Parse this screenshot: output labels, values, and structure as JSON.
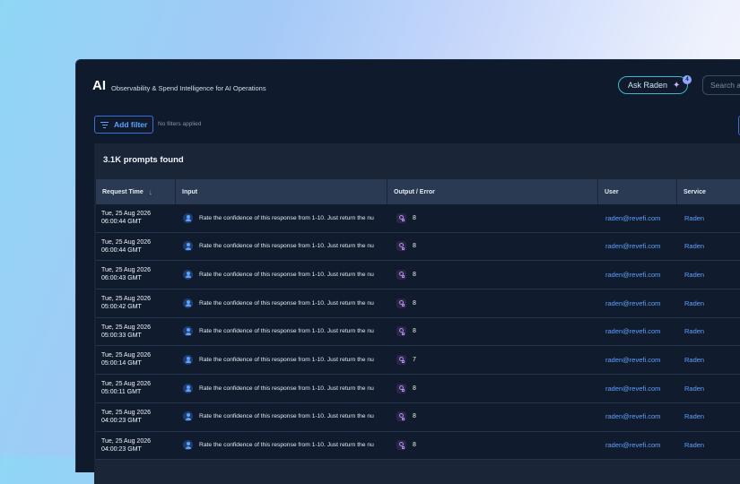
{
  "header": {
    "logo": "AI",
    "subtitle": "Observability & Spend Intelligence for AI Operations",
    "ask_label": "Ask Raden",
    "ask_badge": "4",
    "search_placeholder": "Search a"
  },
  "filters": {
    "add_label": "Add filter",
    "status": "No filters applied"
  },
  "results": {
    "count_label": "3.1K prompts found"
  },
  "table": {
    "columns": [
      "Request Time",
      "Input",
      "Output / Error",
      "User",
      "Service"
    ],
    "rows": [
      {
        "date": "Tue, 25 Aug 2026",
        "time": "06:00:44 GMT",
        "input": "Rate the confidence of this response from 1-10. Just return the nu",
        "output": "8",
        "user": "raden@revefi.com",
        "service": "Raden"
      },
      {
        "date": "Tue, 25 Aug 2026",
        "time": "06:00:44 GMT",
        "input": "Rate the confidence of this response from 1-10. Just return the nu",
        "output": "8",
        "user": "raden@revefi.com",
        "service": "Raden"
      },
      {
        "date": "Tue, 25 Aug 2026",
        "time": "06:00:43 GMT",
        "input": "Rate the confidence of this response from 1-10. Just return the nu",
        "output": "8",
        "user": "raden@revefi.com",
        "service": "Raden"
      },
      {
        "date": "Tue, 25 Aug 2026",
        "time": "05:00:42 GMT",
        "input": "Rate the confidence of this response from 1-10. Just return the nu",
        "output": "8",
        "user": "raden@revefi.com",
        "service": "Raden"
      },
      {
        "date": "Tue, 25 Aug 2026",
        "time": "05:00:33 GMT",
        "input": "Rate the confidence of this response from 1-10. Just return the nu",
        "output": "8",
        "user": "raden@revefi.com",
        "service": "Raden"
      },
      {
        "date": "Tue, 25 Aug 2026",
        "time": "05:00:14 GMT",
        "input": "Rate the confidence of this response from 1-10. Just return the nu",
        "output": "7",
        "user": "raden@revefi.com",
        "service": "Raden"
      },
      {
        "date": "Tue, 25 Aug 2026",
        "time": "05:00:11 GMT",
        "input": "Rate the confidence of this response from 1-10. Just return the nu",
        "output": "8",
        "user": "raden@revefi.com",
        "service": "Raden"
      },
      {
        "date": "Tue, 25 Aug 2026",
        "time": "04:00:23 GMT",
        "input": "Rate the confidence of this response from 1-10. Just return the nu",
        "output": "8",
        "user": "raden@revefi.com",
        "service": "Raden"
      },
      {
        "date": "Tue, 25 Aug 2026",
        "time": "04:00:23 GMT",
        "input": "Rate the confidence of this response from 1-10. Just return the nu",
        "output": "8",
        "user": "raden@revefi.com",
        "service": "Raden"
      }
    ]
  }
}
